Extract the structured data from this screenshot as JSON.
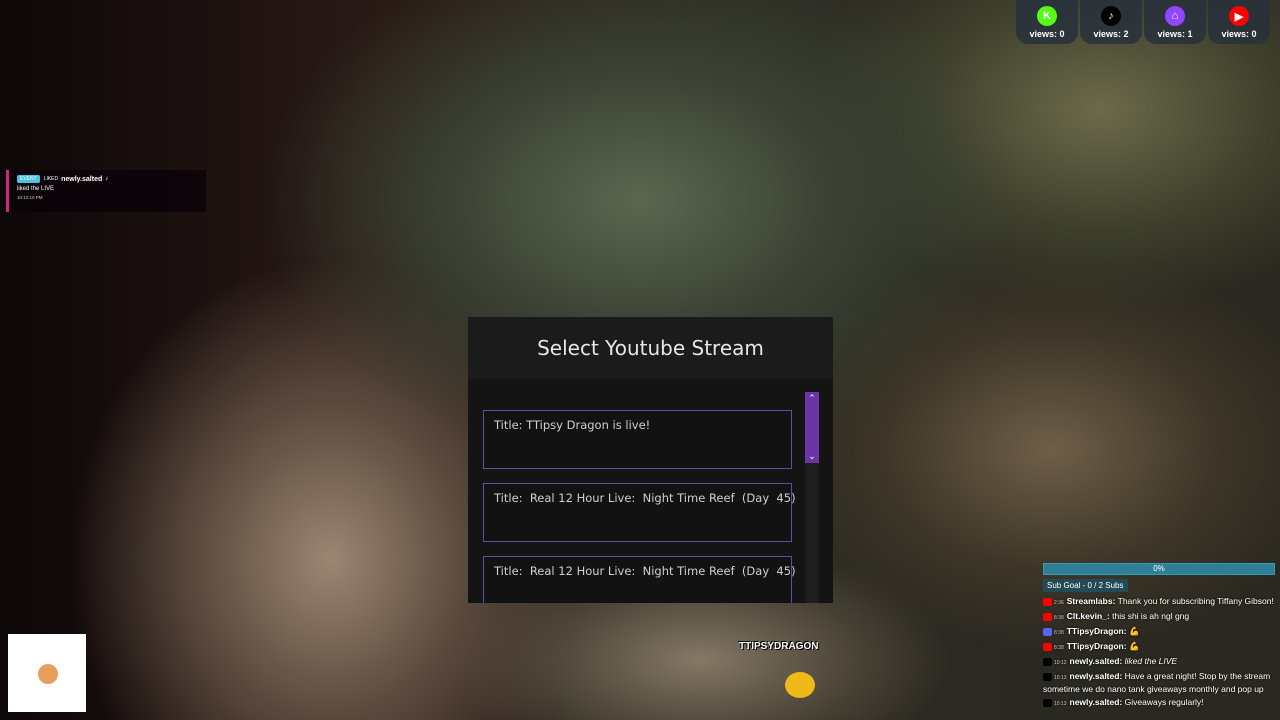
{
  "socials": [
    {
      "name": "kick",
      "views": "views: 0",
      "color": "#53fc18",
      "glyph": "K"
    },
    {
      "name": "tiktok",
      "views": "views: 2",
      "color": "#000000",
      "glyph": "♪"
    },
    {
      "name": "twitch",
      "views": "views: 1",
      "color": "#9146ff",
      "glyph": "⌂"
    },
    {
      "name": "youtube",
      "views": "views: 0",
      "color": "#ff0000",
      "glyph": "▶"
    }
  ],
  "notification": {
    "badge": "EVENT",
    "type": "LIKED",
    "user": "newly.salted",
    "message": "liked the LIVE",
    "time": "10:12:10 PM"
  },
  "modal": {
    "title": "Select Youtube Stream",
    "streams": [
      "Title: TTipsy Dragon is live!",
      "Title:  Real 12 Hour Live:  Night Time Reef  (Day  45)",
      "Title:  Real 12 Hour Live:  Night Time Reef  (Day  45)"
    ],
    "scroll_up": "⌃",
    "scroll_down": "⌄"
  },
  "sub_goal": {
    "percent_label": "0%",
    "progress": 0,
    "label": "Sub Goal - 0 / 2 Subs"
  },
  "chat": [
    {
      "platform": "youtube",
      "color": "#ff0000",
      "time": "2:36",
      "user": "Streamlabs:",
      "text": "Thank you for subscribing Tiffany Gibson!"
    },
    {
      "platform": "youtube",
      "color": "#ff0000",
      "time": "8:38",
      "user": "Clt.kevin_:",
      "text": "this shi is ah ngl gng"
    },
    {
      "platform": "discord",
      "color": "#5865f2",
      "time": "8:38",
      "user": "TTipsyDragon:",
      "text": "💪"
    },
    {
      "platform": "youtube",
      "color": "#ff0000",
      "time": "8:38",
      "user": "TTipsyDragon:",
      "text": "💪"
    },
    {
      "platform": "tiktok",
      "color": "#000000",
      "time": "10:12",
      "user": "newly.salted:",
      "text": "liked the LIVE"
    },
    {
      "platform": "tiktok",
      "color": "#000000",
      "time": "10:13",
      "user": "newly.salted:",
      "text": "Have a great night! Stop by the stream sometime we do nano tank giveaways monthly and pop up"
    },
    {
      "platform": "tiktok",
      "color": "#000000",
      "time": "10:13",
      "user": "newly.salted:",
      "text": "Giveaways regularly!"
    }
  ],
  "overlay": {
    "player_name": "TTIPSYDRAGON"
  }
}
